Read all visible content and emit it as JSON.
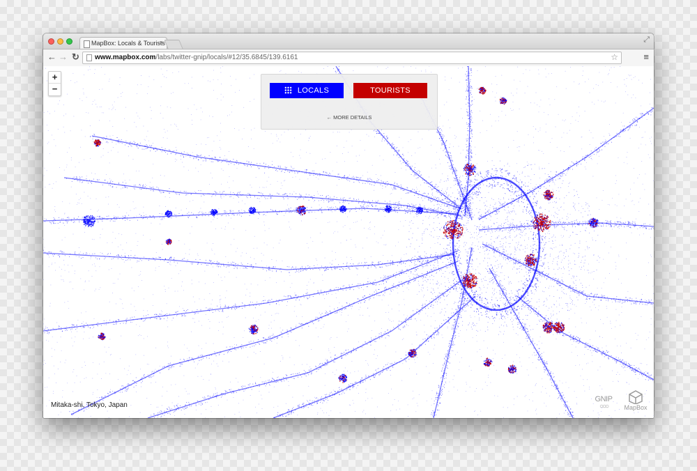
{
  "browser": {
    "tab_title": "MapBox: Locals & Tourists",
    "tab_close": "×",
    "url_host": "www.mapbox.com",
    "url_path": "/labs/twitter-gnip/locals/#12/35.6845/139.6161"
  },
  "map": {
    "zoom_in": "+",
    "zoom_out": "−",
    "locals_label": "LOCALS",
    "tourists_label": "TOURISTS",
    "more_details": "← MORE DETAILS",
    "location": "Mitaka-shi, Tokyo, Japan",
    "gnip_logo": "GNIP",
    "mapbox_logo": "MapBox",
    "colors": {
      "locals": "#0000ff",
      "tourists": "#c40000"
    }
  },
  "icons": [
    "back-arrow-icon",
    "forward-arrow-icon",
    "reload-icon",
    "page-icon",
    "bookmark-star-icon",
    "menu-icon",
    "fullscreen-icon",
    "grid-icon"
  ]
}
